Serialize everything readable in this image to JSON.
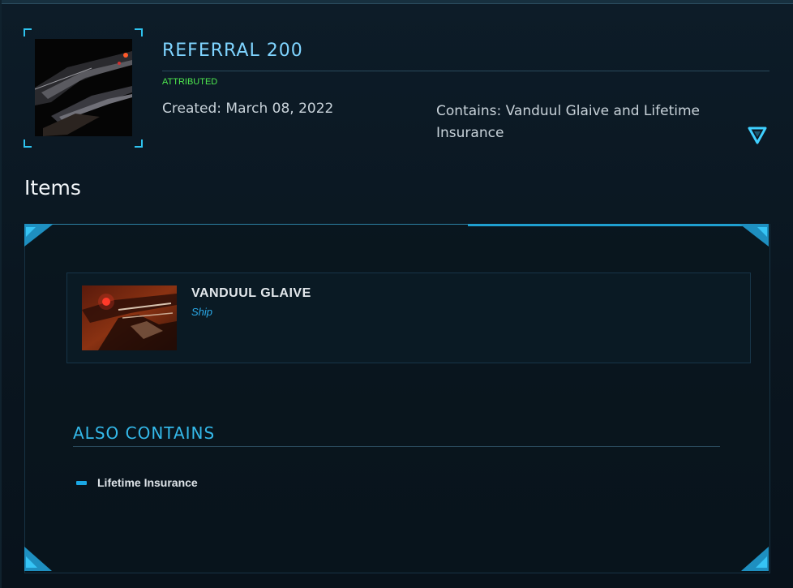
{
  "pledge": {
    "title": "REFERRAL 200",
    "status": "ATTRIBUTED",
    "created": "Created: March 08, 2022",
    "contains": "Contains: Vanduul Glaive and Lifetime Insurance"
  },
  "items_heading": "Items",
  "items": [
    {
      "title": "VANDUUL GLAIVE",
      "kind": "Ship"
    }
  ],
  "also_contains": {
    "heading": "ALSO CONTAINS",
    "entries": [
      "Lifetime Insurance"
    ]
  },
  "colors": {
    "accent": "#2ec3ef",
    "title": "#7fd4ff",
    "status_green": "#4ee84e",
    "background": "#0a1620"
  },
  "icons": {
    "expand": "chevron-down-triangle-icon",
    "bullet": "dash-bullet-icon"
  }
}
